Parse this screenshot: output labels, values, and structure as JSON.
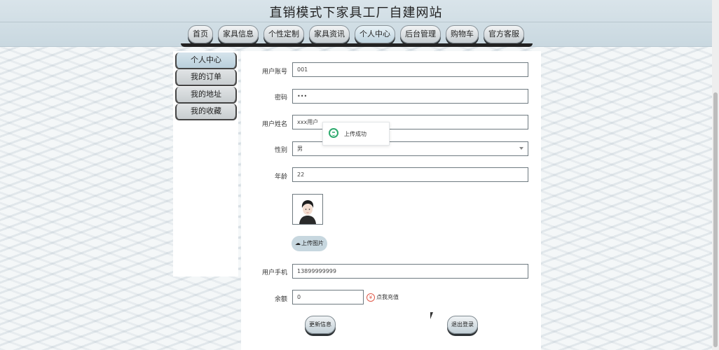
{
  "header": {
    "site_title": "直销模式下家具工厂自建网站"
  },
  "nav": {
    "items": [
      {
        "label": "首页",
        "active": false
      },
      {
        "label": "家具信息",
        "active": false
      },
      {
        "label": "个性定制",
        "active": false
      },
      {
        "label": "家具资讯",
        "active": false
      },
      {
        "label": "个人中心",
        "active": true
      },
      {
        "label": "后台管理",
        "active": false
      },
      {
        "label": "购物车",
        "active": false
      },
      {
        "label": "官方客服",
        "active": false
      }
    ]
  },
  "sidebar": {
    "items": [
      {
        "label": "个人中心",
        "active": true
      },
      {
        "label": "我的订单",
        "active": false
      },
      {
        "label": "我的地址",
        "active": false
      },
      {
        "label": "我的收藏",
        "active": false
      }
    ]
  },
  "form": {
    "account": {
      "label": "用户账号",
      "value": "001"
    },
    "password": {
      "label": "密码",
      "value": "•••"
    },
    "name": {
      "label": "用户姓名",
      "value": "xxx用户"
    },
    "gender": {
      "label": "性别",
      "value": "男"
    },
    "age": {
      "label": "年龄",
      "value": "22"
    },
    "upload_label": "上传图片",
    "phone": {
      "label": "用户手机",
      "value": "13899999999"
    },
    "balance": {
      "label": "余额",
      "value": "0"
    },
    "recharge_label": "点我充值",
    "recharge_icon_glyph": "¥",
    "update_button": "更新信息",
    "logout_button": "退出登录"
  },
  "toast": {
    "message": "上传成功"
  }
}
